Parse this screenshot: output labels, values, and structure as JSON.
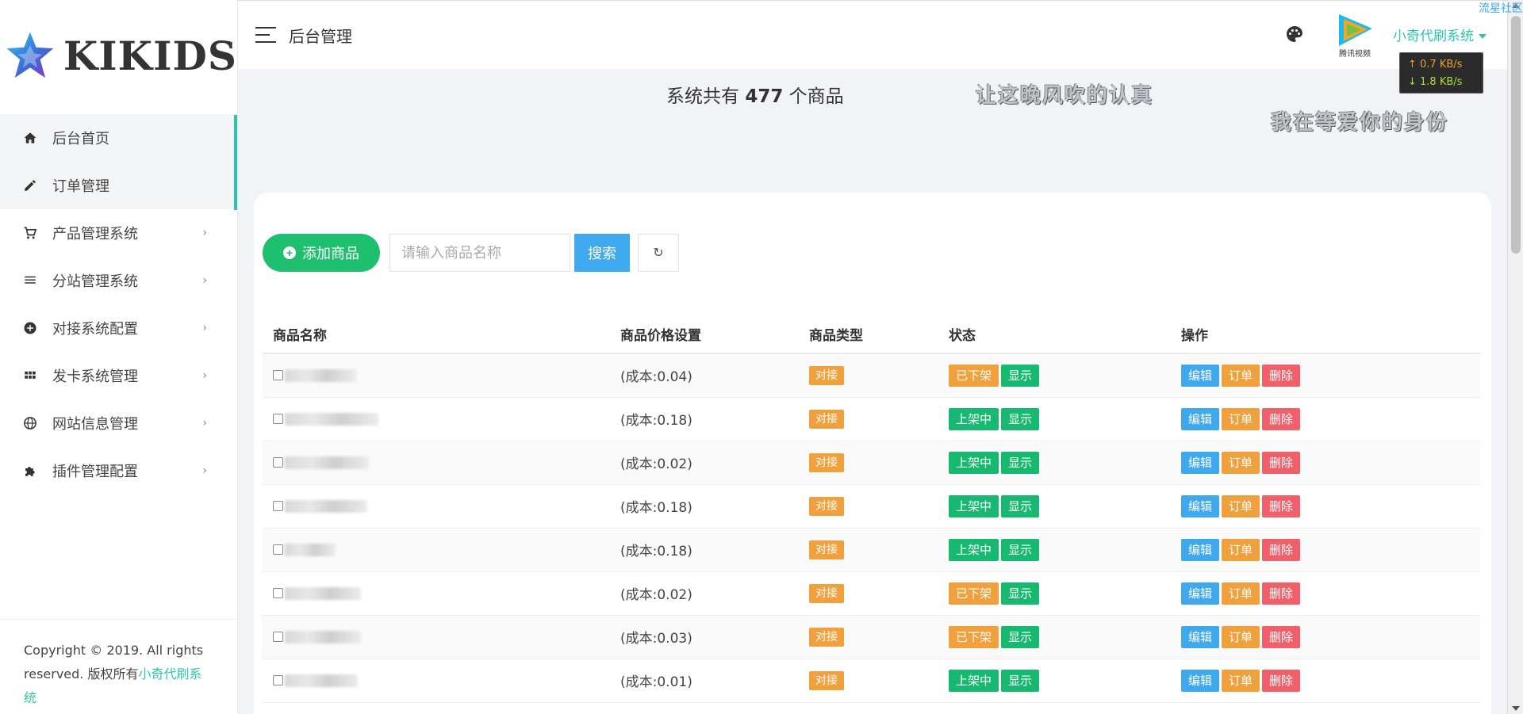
{
  "sidebar": {
    "logo_text": "KIKIDS",
    "items": [
      {
        "label": "后台首页",
        "icon": "home-icon",
        "has_children": false
      },
      {
        "label": "订单管理",
        "icon": "pencil-icon",
        "has_children": false
      },
      {
        "label": "产品管理系统",
        "icon": "cart-icon",
        "has_children": true
      },
      {
        "label": "分站管理系统",
        "icon": "list-icon",
        "has_children": true
      },
      {
        "label": "对接系统配置",
        "icon": "plus-circle-icon",
        "has_children": true
      },
      {
        "label": "发卡系统管理",
        "icon": "grid-icon",
        "has_children": true
      },
      {
        "label": "网站信息管理",
        "icon": "globe-icon",
        "has_children": true
      },
      {
        "label": "插件管理配置",
        "icon": "puzzle-icon",
        "has_children": true
      }
    ],
    "footer": {
      "line1": "Copyright © 2019. All rights",
      "line2_prefix": "reserved. 版权所有",
      "brand": "小奇代刷系统"
    }
  },
  "header": {
    "title": "后台管理",
    "tv_logo_text": "腾讯视频",
    "user_name": "小奇代刷系统",
    "net_up": "↑ 0.7 KB/s",
    "net_down": "↓ 1.8 KB/s",
    "corner_link": "流星社区"
  },
  "summary": {
    "prefix": "系统共有",
    "count": "477",
    "suffix": "个商品"
  },
  "lyrics": {
    "line1": "让这晚风吹的认真",
    "line2": "我在等爱你的身份"
  },
  "toolbar": {
    "add_label": "添加商品",
    "search_placeholder": "请输入商品名称",
    "search_label": "搜索",
    "refresh_icon": "↻"
  },
  "table": {
    "headers": [
      "商品名称",
      "商品价格设置",
      "商品类型",
      "状态",
      "操作"
    ],
    "rows": [
      {
        "price": "(成本:0.04)",
        "type": "对接",
        "status": "已下架",
        "status_kind": "off",
        "visibility": "显示"
      },
      {
        "price": "(成本:0.18)",
        "type": "对接",
        "status": "上架中",
        "status_kind": "on",
        "visibility": "显示"
      },
      {
        "price": "(成本:0.02)",
        "type": "对接",
        "status": "上架中",
        "status_kind": "on",
        "visibility": "显示"
      },
      {
        "price": "(成本:0.18)",
        "type": "对接",
        "status": "上架中",
        "status_kind": "on",
        "visibility": "显示"
      },
      {
        "price": "(成本:0.18)",
        "type": "对接",
        "status": "上架中",
        "status_kind": "on",
        "visibility": "显示"
      },
      {
        "price": "(成本:0.02)",
        "type": "对接",
        "status": "已下架",
        "status_kind": "off",
        "visibility": "显示"
      },
      {
        "price": "(成本:0.03)",
        "type": "对接",
        "status": "已下架",
        "status_kind": "off",
        "visibility": "显示"
      },
      {
        "price": "(成本:0.01)",
        "type": "对接",
        "status": "上架中",
        "status_kind": "on",
        "visibility": "显示"
      }
    ],
    "actions": {
      "edit": "编辑",
      "order": "订单",
      "delete": "删除"
    }
  },
  "colors": {
    "accent": "#2dc5ad",
    "green": "#16b96f",
    "orange": "#f0a03c",
    "blue": "#3fa9ee",
    "red": "#f0606a"
  }
}
